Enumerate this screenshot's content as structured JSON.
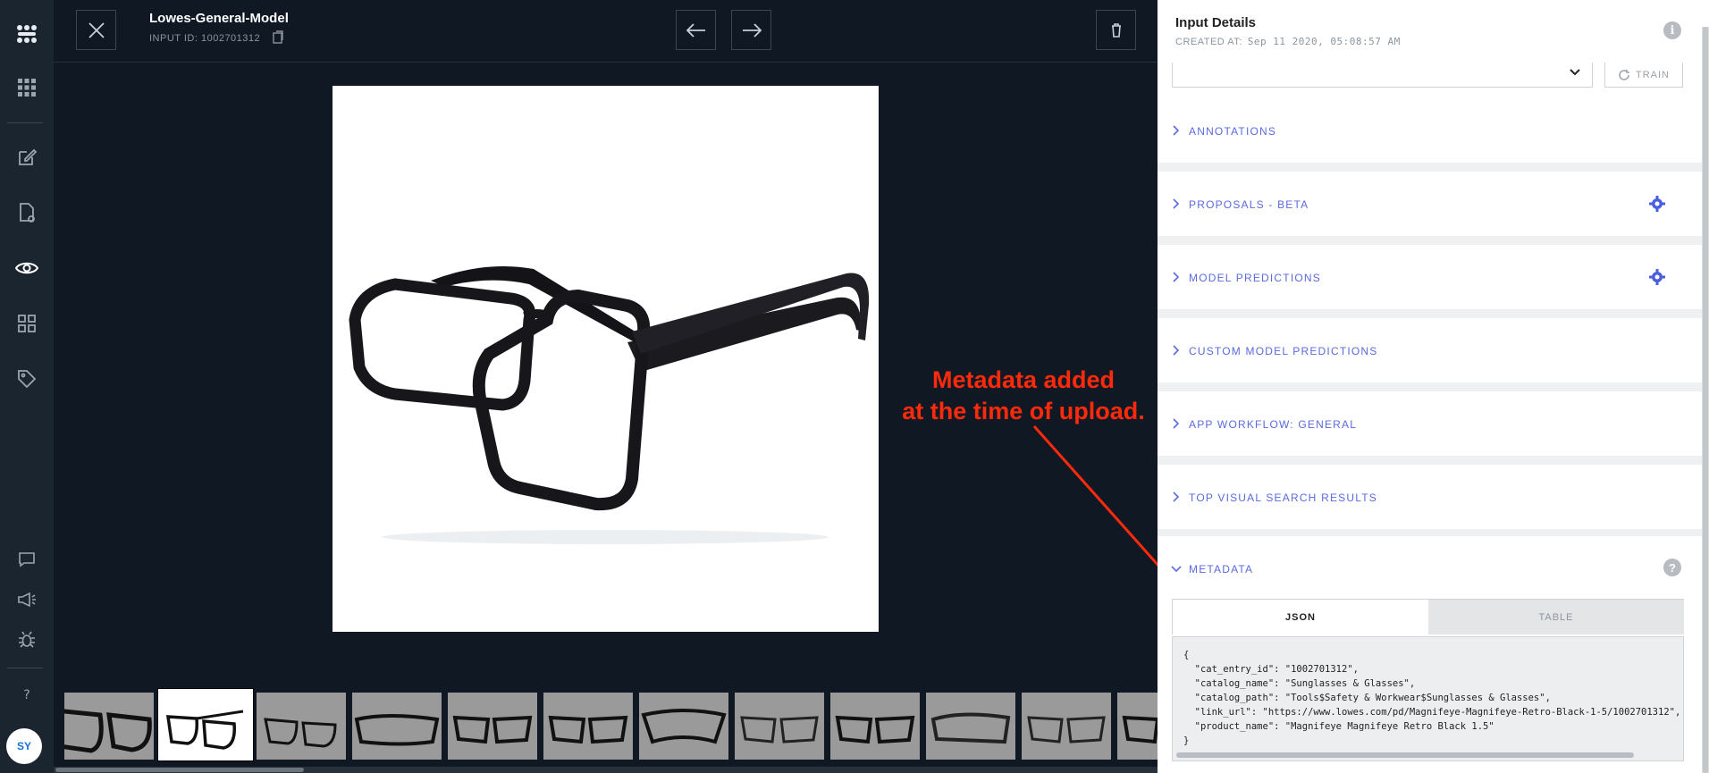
{
  "header": {
    "model_title": "Lowes-General-Model",
    "input_id_label": "INPUT ID: 1002701312"
  },
  "annotation": {
    "line1": "Metadata added",
    "line2": "at the time of upload."
  },
  "panel": {
    "title": "Input Details",
    "created_label": "CREATED AT:",
    "created_value": "Sep 11 2020, 05:08:57 AM",
    "train_label": "TRAIN",
    "sections": [
      {
        "label": "ANNOTATIONS"
      },
      {
        "label": "PROPOSALS - BETA"
      },
      {
        "label": "MODEL PREDICTIONS"
      },
      {
        "label": "CUSTOM MODEL PREDICTIONS"
      },
      {
        "label": "APP WORKFLOW: GENERAL"
      },
      {
        "label": "TOP VISUAL SEARCH RESULTS"
      }
    ],
    "metadata": {
      "label": "METADATA",
      "tab_json": "JSON",
      "tab_table": "TABLE",
      "json_text": "{\n  \"cat_entry_id\": \"1002701312\",\n  \"catalog_name\": \"Sunglasses & Glasses\",\n  \"catalog_path\": \"Tools$Safety & Workwear$Sunglasses & Glasses\",\n  \"link_url\": \"https://www.lowes.com/pd/Magnifeye-Magnifeye-Retro-Black-1-5/1002701312\",\n  \"product_name\": \"Magnifeye Magnifeye Retro Black 1.5\"\n}"
    }
  },
  "user": {
    "initials": "SY"
  },
  "colors": {
    "accent": "#5a6ae0",
    "annotation": "#ff2a0c",
    "dark_bg": "#0f1823"
  }
}
